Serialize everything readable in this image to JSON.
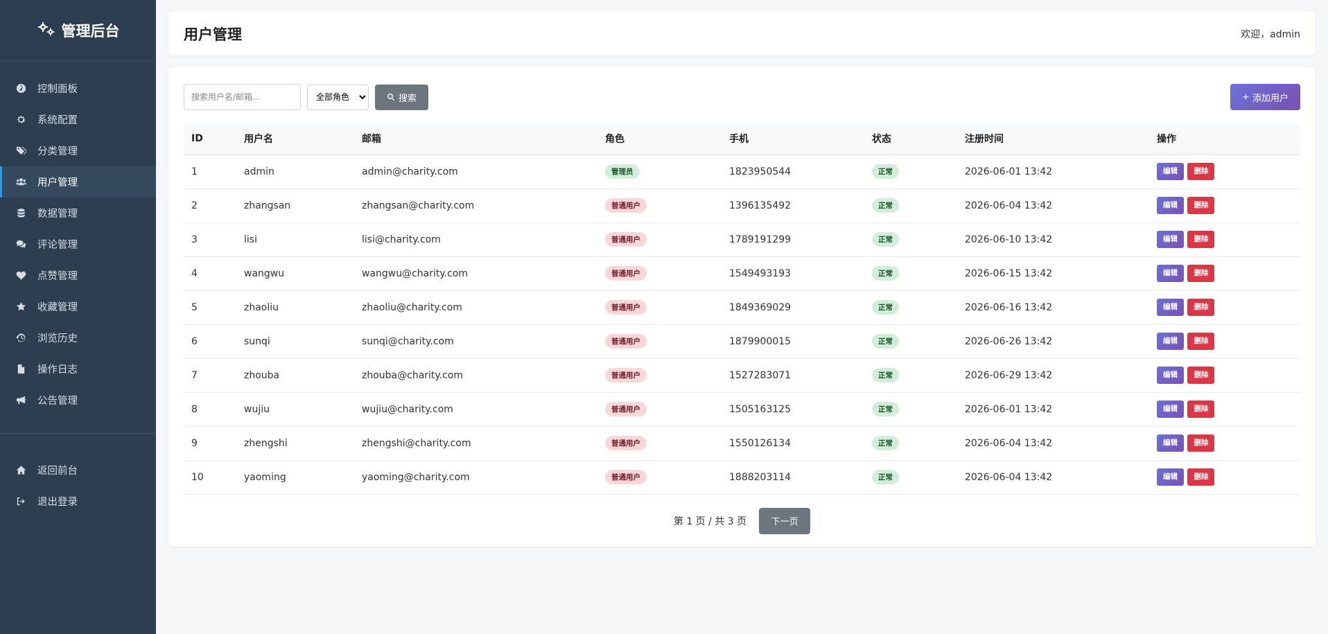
{
  "brand": {
    "title": "管理后台"
  },
  "sidebar": {
    "items": [
      {
        "label": "控制面板",
        "icon": "dashboard-icon"
      },
      {
        "label": "系统配置",
        "icon": "gear-icon"
      },
      {
        "label": "分类管理",
        "icon": "tags-icon"
      },
      {
        "label": "用户管理",
        "icon": "users-icon",
        "active": true
      },
      {
        "label": "数据管理",
        "icon": "database-icon"
      },
      {
        "label": "评论管理",
        "icon": "comments-icon"
      },
      {
        "label": "点赞管理",
        "icon": "heart-icon"
      },
      {
        "label": "收藏管理",
        "icon": "star-icon"
      },
      {
        "label": "浏览历史",
        "icon": "history-icon"
      },
      {
        "label": "操作日志",
        "icon": "file-icon"
      },
      {
        "label": "公告管理",
        "icon": "bullhorn-icon"
      }
    ],
    "bottom_items": [
      {
        "label": "返回前台",
        "icon": "home-icon"
      },
      {
        "label": "退出登录",
        "icon": "sign-out-icon"
      }
    ]
  },
  "header": {
    "title": "用户管理",
    "welcome": "欢迎，admin"
  },
  "toolbar": {
    "search_placeholder": "搜索用户名/邮箱...",
    "role_select": "全部角色",
    "search_label": "搜索",
    "add_label": "添加用户"
  },
  "table": {
    "columns": [
      "ID",
      "用户名",
      "邮箱",
      "角色",
      "手机",
      "状态",
      "注册时间",
      "操作"
    ],
    "edit_label": "编辑",
    "delete_label": "删除",
    "rows": [
      {
        "id": "1",
        "username": "admin",
        "email": "admin@charity.com",
        "role": "管理员",
        "role_type": "admin",
        "phone": "1823950544",
        "status": "正常",
        "created": "2026-06-01 13:42"
      },
      {
        "id": "2",
        "username": "zhangsan",
        "email": "zhangsan@charity.com",
        "role": "普通用户",
        "role_type": "user",
        "phone": "1396135492",
        "status": "正常",
        "created": "2026-06-04 13:42"
      },
      {
        "id": "3",
        "username": "lisi",
        "email": "lisi@charity.com",
        "role": "普通用户",
        "role_type": "user",
        "phone": "1789191299",
        "status": "正常",
        "created": "2026-06-10 13:42"
      },
      {
        "id": "4",
        "username": "wangwu",
        "email": "wangwu@charity.com",
        "role": "普通用户",
        "role_type": "user",
        "phone": "1549493193",
        "status": "正常",
        "created": "2026-06-15 13:42"
      },
      {
        "id": "5",
        "username": "zhaoliu",
        "email": "zhaoliu@charity.com",
        "role": "普通用户",
        "role_type": "user",
        "phone": "1849369029",
        "status": "正常",
        "created": "2026-06-16 13:42"
      },
      {
        "id": "6",
        "username": "sunqi",
        "email": "sunqi@charity.com",
        "role": "普通用户",
        "role_type": "user",
        "phone": "1879900015",
        "status": "正常",
        "created": "2026-06-26 13:42"
      },
      {
        "id": "7",
        "username": "zhouba",
        "email": "zhouba@charity.com",
        "role": "普通用户",
        "role_type": "user",
        "phone": "1527283071",
        "status": "正常",
        "created": "2026-06-29 13:42"
      },
      {
        "id": "8",
        "username": "wujiu",
        "email": "wujiu@charity.com",
        "role": "普通用户",
        "role_type": "user",
        "phone": "1505163125",
        "status": "正常",
        "created": "2026-06-01 13:42"
      },
      {
        "id": "9",
        "username": "zhengshi",
        "email": "zhengshi@charity.com",
        "role": "普通用户",
        "role_type": "user",
        "phone": "1550126134",
        "status": "正常",
        "created": "2026-06-04 13:42"
      },
      {
        "id": "10",
        "username": "yaoming",
        "email": "yaoming@charity.com",
        "role": "普通用户",
        "role_type": "user",
        "phone": "1888203114",
        "status": "正常",
        "created": "2026-06-04 13:42"
      }
    ]
  },
  "pagination": {
    "info": "第 1 页 / 共 3 页",
    "next_label": "下一页"
  },
  "colors": {
    "sidebar_bg": "#2c3e50",
    "accent": "#6a72d6",
    "danger": "#dc3545",
    "secondary": "#6c757d"
  }
}
